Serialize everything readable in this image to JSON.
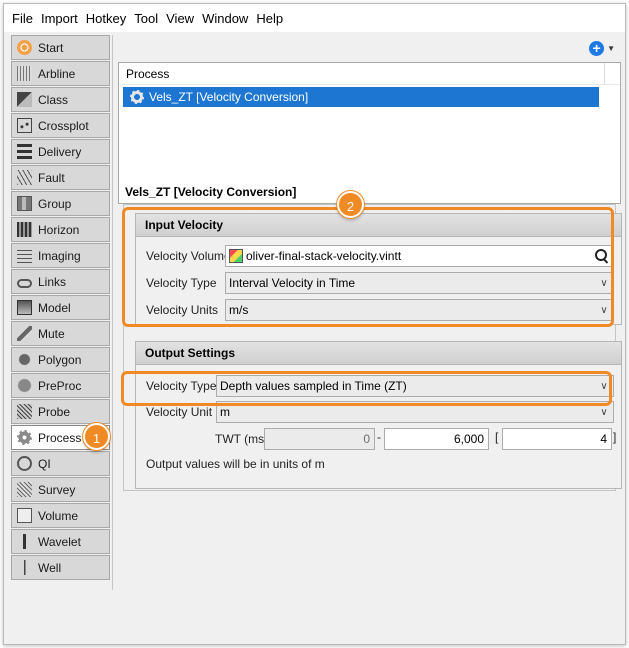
{
  "menu": [
    "File",
    "Import",
    "Hotkey",
    "Tool",
    "View",
    "Window",
    "Help"
  ],
  "sidebar": {
    "items": [
      {
        "label": "Start",
        "icon": "start-icon"
      },
      {
        "label": "Arbline",
        "icon": "arbline-icon"
      },
      {
        "label": "Class",
        "icon": "class-icon"
      },
      {
        "label": "Crossplot",
        "icon": "crossplot-icon"
      },
      {
        "label": "Delivery",
        "icon": "delivery-icon"
      },
      {
        "label": "Fault",
        "icon": "fault-icon"
      },
      {
        "label": "Group",
        "icon": "group-icon"
      },
      {
        "label": "Horizon",
        "icon": "horizon-icon"
      },
      {
        "label": "Imaging",
        "icon": "imaging-icon"
      },
      {
        "label": "Links",
        "icon": "links-icon"
      },
      {
        "label": "Model",
        "icon": "model-icon"
      },
      {
        "label": "Mute",
        "icon": "mute-icon"
      },
      {
        "label": "Polygon",
        "icon": "polygon-icon"
      },
      {
        "label": "PreProc",
        "icon": "preproc-icon"
      },
      {
        "label": "Probe",
        "icon": "probe-icon"
      },
      {
        "label": "Process",
        "icon": "gear-icon",
        "active": true
      },
      {
        "label": "QI",
        "icon": "qi-icon"
      },
      {
        "label": "Survey",
        "icon": "survey-icon"
      },
      {
        "label": "Volume",
        "icon": "volume-icon"
      },
      {
        "label": "Wavelet",
        "icon": "wavelet-icon"
      },
      {
        "label": "Well",
        "icon": "well-icon"
      }
    ]
  },
  "process_list": {
    "header": "Process",
    "selected_item": "Vels_ZT [Velocity Conversion]"
  },
  "panel": {
    "title": "Vels_ZT [Velocity Conversion]",
    "input_group": {
      "title": "Input Velocity",
      "velocity_volume_label": "Velocity Volume",
      "velocity_volume_value": "oliver-final-stack-velocity.vintt",
      "velocity_type_label": "Velocity Type",
      "velocity_type_value": "Interval Velocity in Time",
      "velocity_units_label": "Velocity Units",
      "velocity_units_value": "m/s"
    },
    "output_group": {
      "title": "Output Settings",
      "velocity_type_label": "Velocity Type",
      "velocity_type_value": "Depth values sampled in Time (ZT)",
      "velocity_unit_label": "Velocity Unit",
      "velocity_unit_value": "m",
      "twt_label": "TWT (ms)",
      "twt_start": "0",
      "twt_sep1": "-",
      "twt_end": "6,000",
      "twt_sep2": "[",
      "twt_step": "4",
      "twt_close": "]",
      "note": "Output values will be in units of m"
    }
  },
  "callouts": {
    "badge1": "1",
    "badge2": "2"
  },
  "colors": {
    "accent": "#f08a24",
    "selection": "#1c76d2",
    "add_button": "#1d79e4"
  }
}
